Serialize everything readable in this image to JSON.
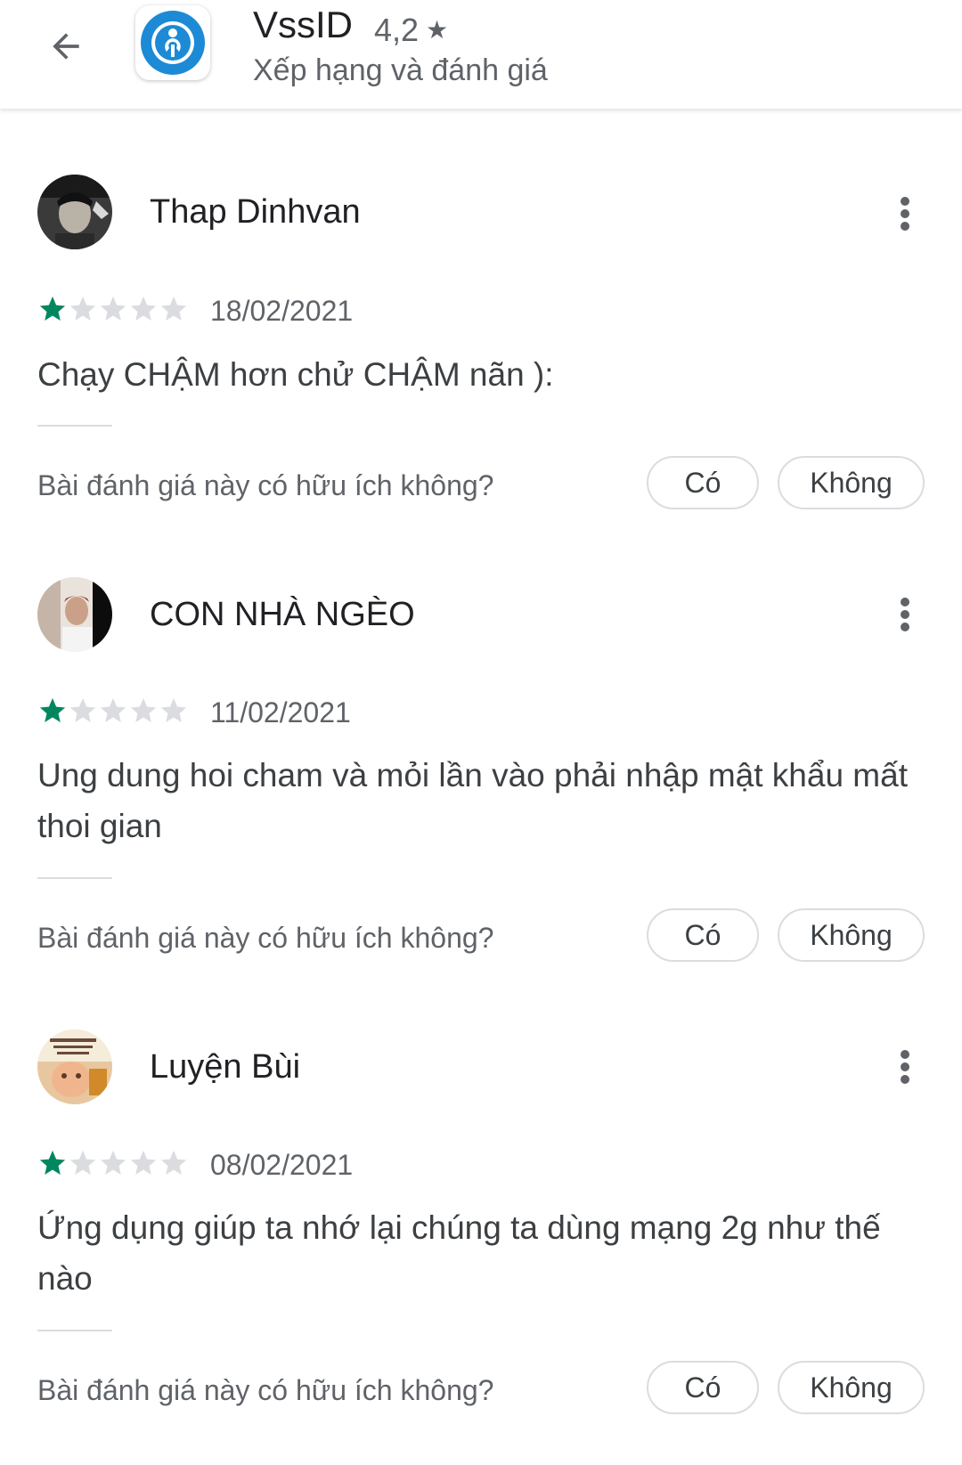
{
  "header": {
    "back_icon": "arrow-left-icon",
    "app_name": "VssID",
    "rating": "4,2",
    "rating_star": "★",
    "subtitle": "Xếp hạng và đánh giá"
  },
  "colors": {
    "star_filled": "#01875f",
    "star_empty": "#dadce0",
    "text_primary": "#202124",
    "text_secondary": "#5f6368"
  },
  "reviews": [
    {
      "name": "Thap Dinhvan",
      "stars": 1,
      "date": "18/02/2021",
      "text": "Chạy CHẬM hơn chử CHẬM nãn ):",
      "helpful_question": "Bài đánh giá này có hữu ích không?",
      "yes_label": "Có",
      "no_label": "Không"
    },
    {
      "name": "CON NHÀ NGÈO",
      "stars": 1,
      "date": "11/02/2021",
      "text": "Ung dung hoi cham và mỏi lần vào phải nhập mật khẩu mất thoi gian",
      "helpful_question": "Bài đánh giá này có hữu ích không?",
      "yes_label": "Có",
      "no_label": "Không"
    },
    {
      "name": "Luyện Bùi",
      "stars": 1,
      "date": "08/02/2021",
      "text": "Ứng dụng giúp ta nhớ lại chúng ta dùng mạng 2g như thế nào",
      "helpful_question": "Bài đánh giá này có hữu ích không?",
      "yes_label": "Có",
      "no_label": "Không"
    }
  ]
}
